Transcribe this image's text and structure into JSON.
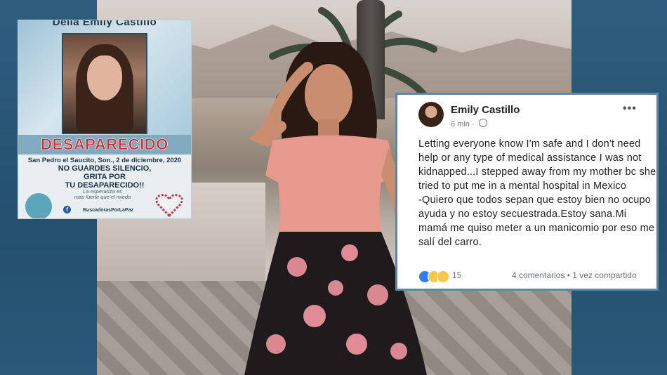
{
  "poster": {
    "name": "Delia Emily Castillo",
    "title": "DESAPARECIDO",
    "place_date": "San Pedro el Saucito, Son., 2 de diciembre, 2020",
    "call": "NO GUARDES SILENCIO,\nGRITA POR\nTU DESAPARECIDO!!",
    "hope": "La esperanza es\nmas fuerte que el miedo",
    "handle": "BuscadorasPorLaPaz",
    "fb": "f"
  },
  "post": {
    "author": "Emily Castillo",
    "time": "6 min",
    "more": "•••",
    "text": "Letting everyone know I'm safe and I don't need help or any type of medical assistance I was not kidnapped...I stepped away from my mother bc she tried to put me in a mental hospital in Mexico\n-Quiero que todos sepan que estoy bien no ocupo ayuda y no estoy secuestrada.Estoy sana.Mi mamá me quiso meter a un manicomio por eso me salí del carro.",
    "reaction_count": "15",
    "stats": "4 comentarios • 1 vez compartido"
  },
  "colors": {
    "frame": "#2c5877",
    "poster_red": "#d8262b",
    "fb_blue": "#2f7df4"
  }
}
